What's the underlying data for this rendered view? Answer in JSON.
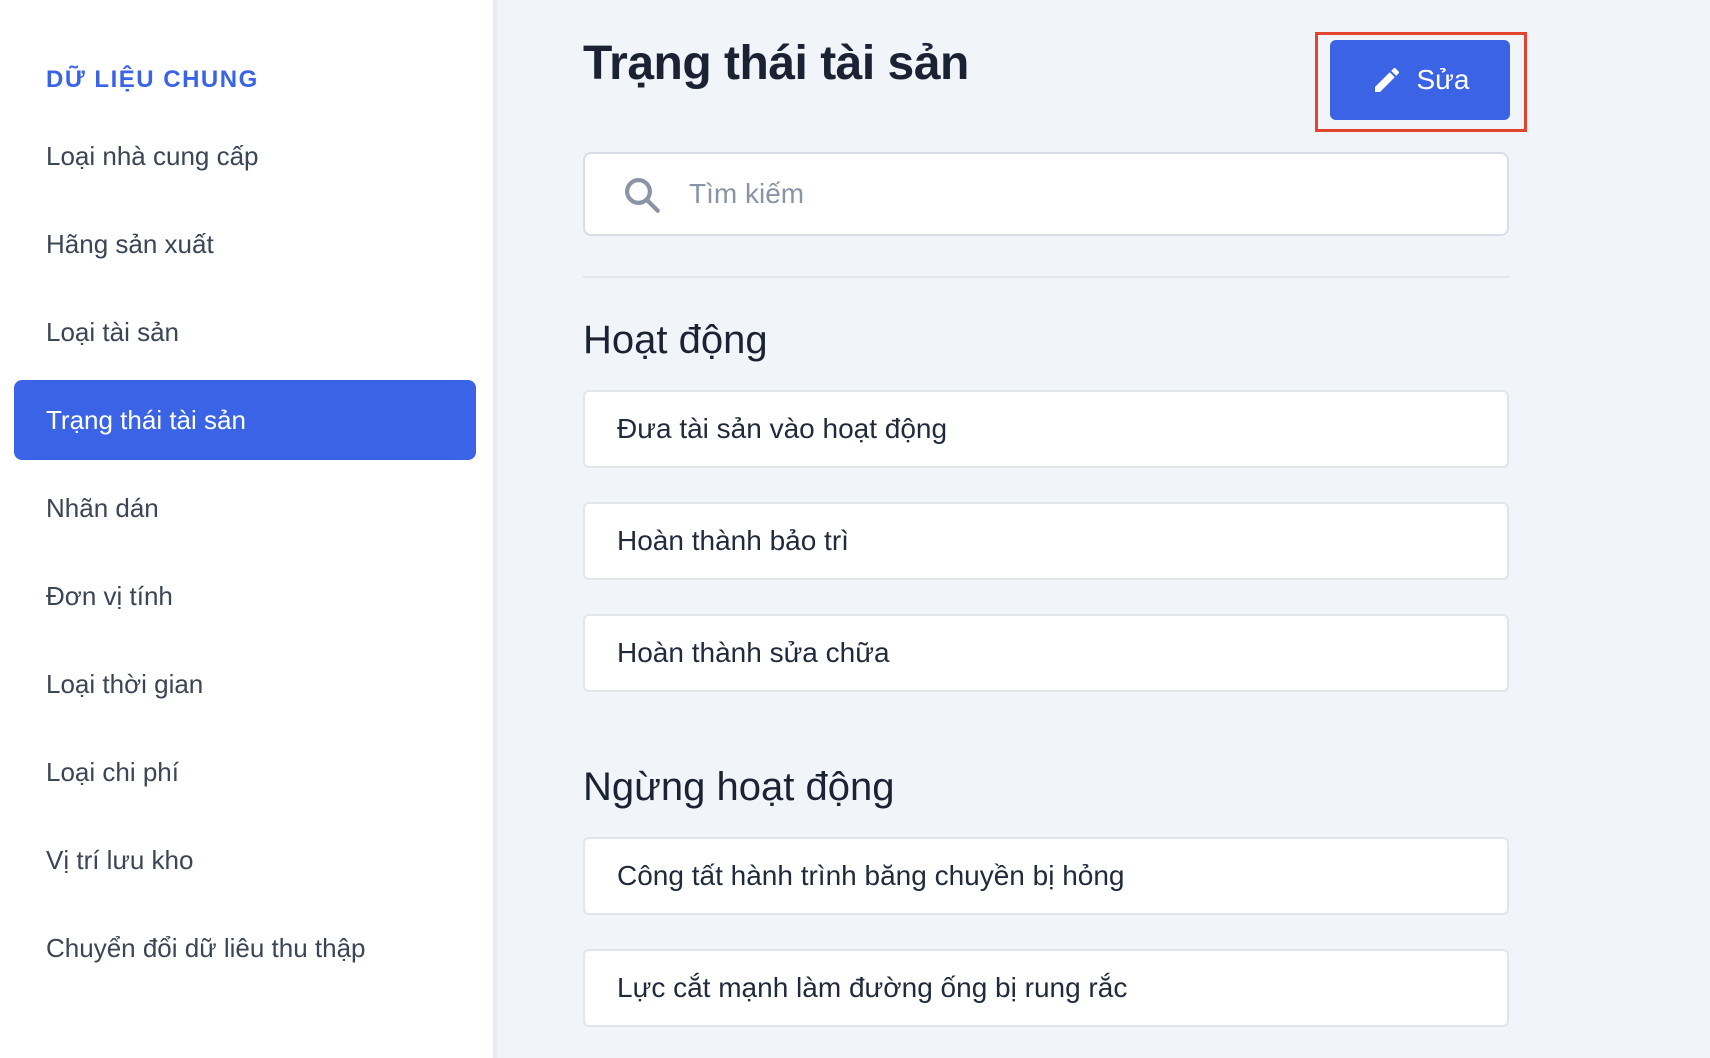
{
  "sidebar": {
    "heading": "DỮ LIỆU CHUNG",
    "items": [
      {
        "label": "Loại nhà cung cấp"
      },
      {
        "label": "Hãng sản xuất"
      },
      {
        "label": "Loại tài sản"
      },
      {
        "label": "Trạng thái tài sản",
        "active": true
      },
      {
        "label": "Nhãn dán"
      },
      {
        "label": "Đơn vị tính"
      },
      {
        "label": "Loại thời gian"
      },
      {
        "label": "Loại chi phí"
      },
      {
        "label": "Vị trí lưu kho"
      },
      {
        "label": "Chuyển đổi dữ liêu thu thập"
      }
    ]
  },
  "header": {
    "title": "Trạng thái tài sản",
    "edit_label": "Sửa",
    "edit_icon": "pencil-icon"
  },
  "search": {
    "placeholder": "Tìm kiếm",
    "value": "",
    "icon": "search-icon"
  },
  "sections": [
    {
      "title": "Hoạt động",
      "items": [
        "Đưa tài sản vào hoạt động",
        "Hoàn thành bảo trì",
        "Hoàn thành sửa chữa"
      ]
    },
    {
      "title": "Ngừng hoạt động",
      "items": [
        "Công tất hành trình băng chuyền bị hỏng",
        "Lực cắt mạnh làm đường ống bị rung rắc"
      ]
    }
  ],
  "colors": {
    "accent": "#3a63e6",
    "highlight_border": "#e2452f",
    "background": "#f1f4f9"
  }
}
